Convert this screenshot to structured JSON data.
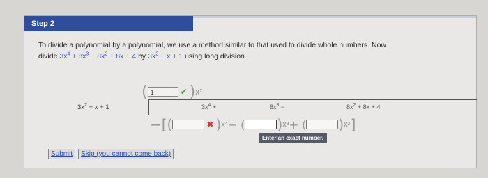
{
  "step": {
    "title": "Step 2"
  },
  "instructions": {
    "line1": "To divide a polynomial by a polynomial, we use a method similar to that used to divide whole numbers. Now",
    "line2_prefix": "divide",
    "dividend_expr": {
      "t1": "3x",
      "e1": "4",
      "t2": " + 8x",
      "e2": "3",
      "t3": " − 8x",
      "e3": "2",
      "t4": " + 8x + 4"
    },
    "by_text": "by",
    "divisor_expr": {
      "t1": "3x",
      "e1": "2",
      "t2": " − x + 1"
    },
    "suffix": "using long division."
  },
  "quotient": {
    "first_term_value": "1",
    "first_term_status": "check-icon",
    "var": "x",
    "exp": "2"
  },
  "long_division": {
    "divisor": {
      "t1": "3x",
      "e1": "2",
      "t2": " − x + 1"
    },
    "dividend_terms": [
      {
        "base": "3x",
        "exp": "4",
        "op": " +"
      },
      {
        "base": "8x",
        "exp": "3",
        "op": " −"
      },
      {
        "base": "8x",
        "exp": "2",
        "op": " + 8x + 4"
      }
    ],
    "subtraction_row": {
      "lead": "−[(",
      "box1_status": "x-icon",
      "var1": "x",
      "exp1": "4",
      "mid": " − (",
      "var2": "x",
      "exp2": "3",
      "mid2": " + (",
      "var3": "x",
      "exp3": "2",
      "close": "]"
    }
  },
  "tooltip": {
    "text": "Enter an exact number."
  },
  "buttons": {
    "submit": "Submit",
    "skip": "Skip (you cannot come back)"
  },
  "colors": {
    "header_bg": "#2f4d9a",
    "accent_blue": "#3f4fae",
    "check": "#4a9a3a",
    "error": "#c23a3a"
  }
}
